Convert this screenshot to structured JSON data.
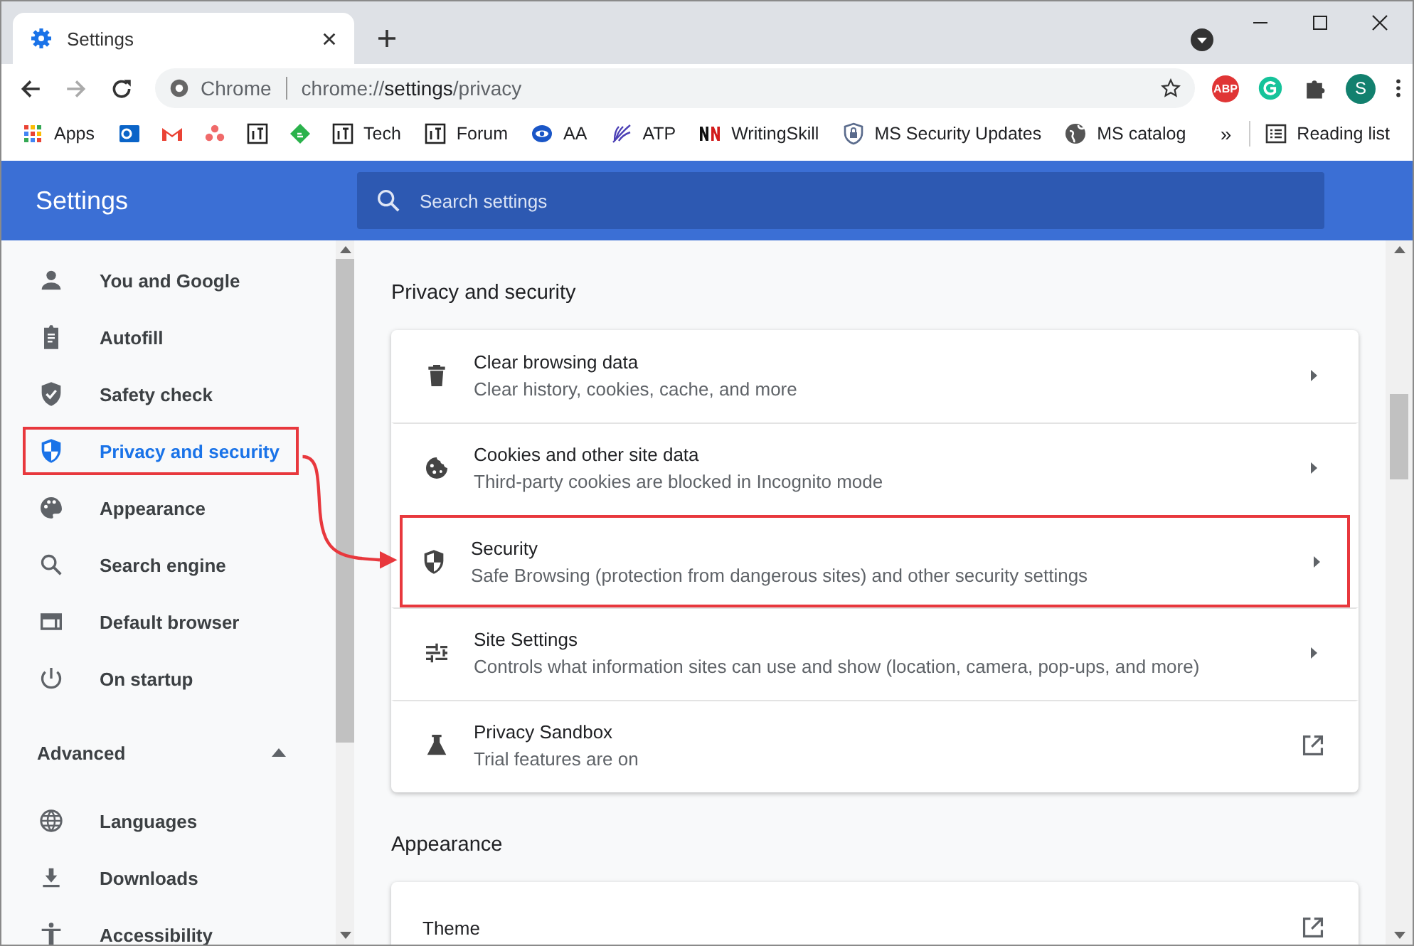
{
  "browser": {
    "tab_title": "Settings",
    "omnibox_chip": "Chrome",
    "url_host": "chrome://",
    "url_path_bold": "settings",
    "url_rest": "/privacy",
    "profile_initial": "S",
    "extension_badge": "ABP"
  },
  "bookmarks": [
    "Apps",
    "Tech",
    "Forum",
    "AA",
    "ATP",
    "WritingSkill",
    "MS Security Updates",
    "MS catalog"
  ],
  "overflow": "»",
  "reading_list": "Reading list",
  "header": {
    "title": "Settings",
    "search_placeholder": "Search settings"
  },
  "sidebar": {
    "items": [
      {
        "label": "You and Google",
        "selected": false,
        "highlighted": false
      },
      {
        "label": "Autofill",
        "selected": false,
        "highlighted": false
      },
      {
        "label": "Safety check",
        "selected": false,
        "highlighted": false
      },
      {
        "label": "Privacy and security",
        "selected": true,
        "highlighted": true
      },
      {
        "label": "Appearance",
        "selected": false,
        "highlighted": false
      },
      {
        "label": "Search engine",
        "selected": false,
        "highlighted": false
      },
      {
        "label": "Default browser",
        "selected": false,
        "highlighted": false
      },
      {
        "label": "On startup",
        "selected": false,
        "highlighted": false
      }
    ],
    "advanced": {
      "label": "Advanced",
      "expanded": true
    },
    "advanced_items": [
      {
        "label": "Languages",
        "selected": false,
        "highlighted": false
      },
      {
        "label": "Downloads",
        "selected": false,
        "highlighted": false
      },
      {
        "label": "Accessibility",
        "selected": false,
        "highlighted": false
      }
    ]
  },
  "sections": [
    {
      "title": "Privacy and security",
      "rows": [
        {
          "title": "Clear browsing data",
          "subtitle": "Clear history, cookies, cache, and more",
          "kind": "arrow",
          "highlighted": false
        },
        {
          "title": "Cookies and other site data",
          "subtitle": "Third-party cookies are blocked in Incognito mode",
          "kind": "arrow",
          "highlighted": false
        },
        {
          "title": "Security",
          "subtitle": "Safe Browsing (protection from dangerous sites) and other security settings",
          "kind": "arrow",
          "highlighted": true
        },
        {
          "title": "Site Settings",
          "subtitle": "Controls what information sites can use and show (location, camera, pop-ups, and more)",
          "kind": "arrow",
          "highlighted": false
        },
        {
          "title": "Privacy Sandbox",
          "subtitle": "Trial features are on",
          "kind": "external",
          "highlighted": false
        }
      ]
    },
    {
      "title": "Appearance",
      "rows": [
        {
          "title": "Theme",
          "kind": "external",
          "highlighted": false
        }
      ]
    }
  ]
}
